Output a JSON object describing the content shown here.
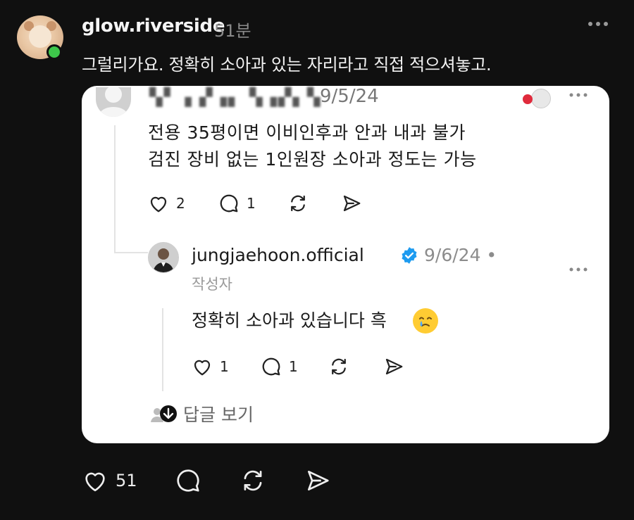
{
  "post": {
    "username": "glow.riverside",
    "time": "51분",
    "text": "그럴리가요. 정확히 소아과 있는 자리라고 직접 적으셔놓고.",
    "likes": "51"
  },
  "card": {
    "comment1": {
      "blurred_user": "▚▘ ▖▞▗▖ ▚▗▞▖▚",
      "date": "9/5/24",
      "line1": "전용 35평이면 이비인후과 안과 내과 불가",
      "line2": "검진 장비 없는 1인원장 소아과 정도는 가능",
      "likes": "2",
      "replies": "1"
    },
    "comment2": {
      "username": "jungjaehoon.official",
      "date": "9/6/24 •",
      "author_tag": "작성자",
      "text": "정확히 소아과 있습니다 흑",
      "likes": "1",
      "replies": "1"
    },
    "view_replies": "답글 보기"
  },
  "colors": {
    "background": "#101010",
    "online": "#3ec74b",
    "verified": "#1d9bf0",
    "heart_badge": "#e02a3c"
  },
  "icons": [
    "heart-icon",
    "comment-icon",
    "repost-icon",
    "share-icon",
    "more-icon",
    "verified-badge-icon"
  ]
}
